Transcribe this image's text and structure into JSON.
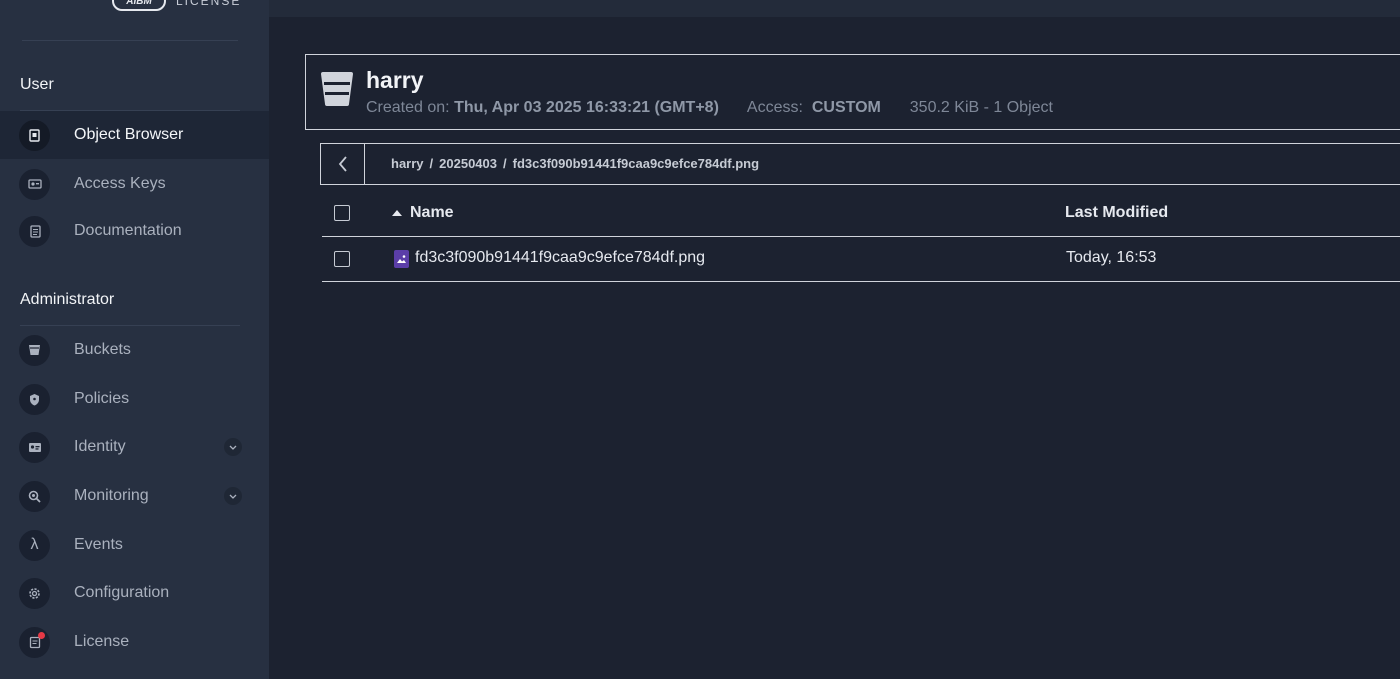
{
  "brand": {
    "logo_text": "AIBM",
    "license_label": "LICENSE"
  },
  "sidebar": {
    "user_title": "User",
    "user_items": [
      {
        "label": "Object Browser",
        "icon": "object-browser-icon",
        "active": true
      },
      {
        "label": "Access Keys",
        "icon": "access-keys-icon"
      },
      {
        "label": "Documentation",
        "icon": "documentation-icon"
      }
    ],
    "admin_title": "Administrator",
    "admin_items": [
      {
        "label": "Buckets",
        "icon": "buckets-icon"
      },
      {
        "label": "Policies",
        "icon": "policies-icon"
      },
      {
        "label": "Identity",
        "icon": "identity-icon",
        "expandable": true
      },
      {
        "label": "Monitoring",
        "icon": "monitoring-icon",
        "expandable": true
      },
      {
        "label": "Events",
        "icon": "lambda-icon"
      },
      {
        "label": "Configuration",
        "icon": "gear-icon"
      },
      {
        "label": "License",
        "icon": "license-icon",
        "badge": true
      }
    ]
  },
  "bucket": {
    "name": "harry",
    "created_label": "Created on:",
    "created_value": "Thu, Apr 03 2025 16:33:21 (GMT+8)",
    "access_label": "Access:",
    "access_value": "CUSTOM",
    "size_summary": "350.2 KiB - 1 Object"
  },
  "breadcrumb": [
    "harry",
    "20250403",
    "fd3c3f090b91441f9caa9c9efce784df.png"
  ],
  "table": {
    "columns": {
      "name": "Name",
      "last_modified": "Last Modified"
    },
    "rows": [
      {
        "name": "fd3c3f090b91441f9caa9c9efce784df.png",
        "last_modified": "Today, 16:53"
      }
    ]
  },
  "colors": {
    "accent_file": "#5b3ea8",
    "badge": "#e53946",
    "sidebar_bg": "#273041",
    "main_bg": "#1c2230"
  }
}
